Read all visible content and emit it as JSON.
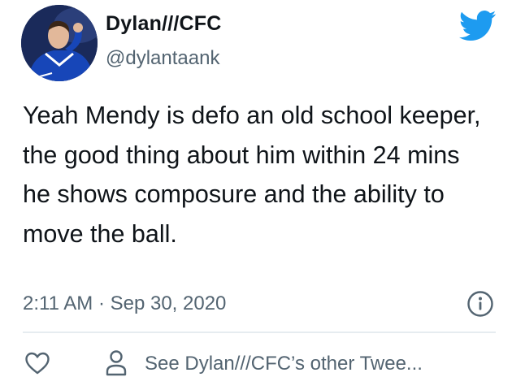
{
  "user": {
    "display_name": "Dylan///CFC",
    "handle": "@dylantaank"
  },
  "tweet": {
    "text": "Yeah Mendy is defo an old school keeper, the good thing about him within 24 mins he shows composure and the ability to move the ball.",
    "timestamp": "2:11 AM · Sep 30, 2020"
  },
  "actions": {
    "other_tweets_label": "See Dylan///CFC’s other Twee..."
  },
  "icons": {
    "brand": "twitter-bird-icon",
    "info": "info-icon",
    "like": "heart-icon",
    "profile": "person-icon"
  },
  "colors": {
    "twitter_blue": "#1d9bf0",
    "text_primary": "#0f1419",
    "text_secondary": "#536471",
    "divider": "#e6ecf0"
  }
}
